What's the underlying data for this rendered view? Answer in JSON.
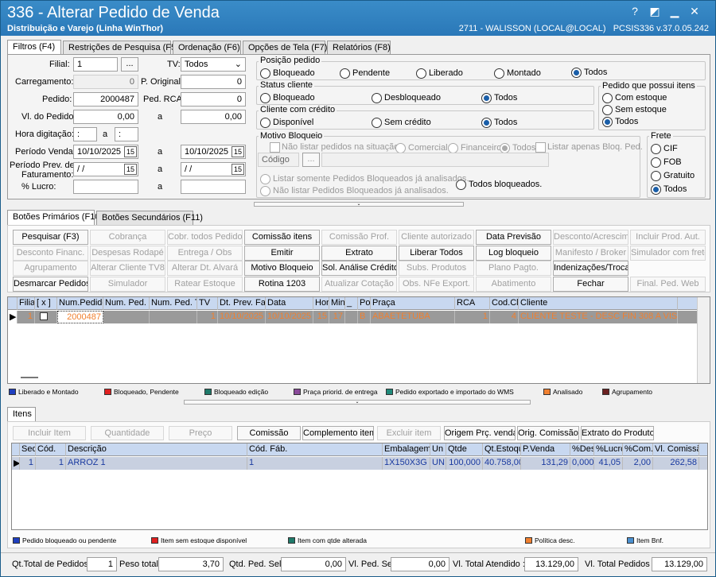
{
  "title": {
    "main": "336 - Alterar Pedido de Venda",
    "sub": "Distribuição e Varejo (Linha WinThor)",
    "user": "2711 - WALISSON (LOCAL@LOCAL)",
    "version": "PCSIS336  v.37.0.05.242"
  },
  "tabs": [
    "Filtros (F4)",
    "Restrições de Pesquisa (F5)",
    "Ordenação (F6)",
    "Opções de Tela (F7)",
    "Relatórios (F8)"
  ],
  "filters": {
    "filial_label": "Filial:",
    "filial": "1",
    "tv_label": "TV:",
    "tv": "Todos",
    "carregamento_label": "Carregamento:",
    "carregamento": "0",
    "poriginal_label": "P. Original:",
    "poriginal": "0",
    "pedido_label": "Pedido:",
    "pedido": "2000487",
    "pedrca_label": "Ped. RCA:",
    "pedrca": "0",
    "vlpedido_label": "Vl. do Pedido:",
    "vlpedido_from": "0,00",
    "a": "a",
    "vlpedido_to": "0,00",
    "hora_label": "Hora digitação:",
    "hora_from": ":",
    "hora_to": ":",
    "periodo_label": "Período Venda:",
    "periodo_from": "10/10/2025",
    "periodo_to": "10/10/2025",
    "periodo_prev_label1": "Período Prev. de",
    "periodo_prev_label2": "Faturamento:",
    "prev_from": "/ /",
    "prev_to": "/ /",
    "lucro_label": "% Lucro:",
    "cal": "15",
    "ellipsis": "..."
  },
  "posicao": {
    "title": "Posição pedido",
    "options": [
      "Bloqueado",
      "Pendente",
      "Liberado",
      "Montado",
      "Todos"
    ]
  },
  "status_cliente": {
    "title": "Status cliente",
    "options": [
      "Bloqueado",
      "Desbloqueado",
      "Todos"
    ]
  },
  "cliente_credito": {
    "title": "Cliente com crédito",
    "options": [
      "Disponível",
      "Sem crédito",
      "Todos"
    ]
  },
  "pedido_itens": {
    "title": "Pedido que possui itens",
    "options": [
      "Com estoque",
      "Sem estoque",
      "Todos"
    ]
  },
  "motivo": {
    "title": "Motivo Bloqueio",
    "nao_listar": "Não listar pedidos na situação:",
    "comercial": "Comercial",
    "financeiro": "Financeiro",
    "todos": "Todos",
    "listar_bloq": "Listar apenas Bloq. Ped.",
    "codigo": "Código",
    "somente": "Listar somente Pedidos Bloqueados já analisados.",
    "nao_listar_bloq": "Não listar Pedidos Bloqueados já analisados.",
    "todos_bloq": "Todos bloqueados."
  },
  "frete": {
    "title": "Frete",
    "options": [
      "CIF",
      "FOB",
      "Gratuito",
      "Todos"
    ]
  },
  "button_tabs": [
    "Botões Primários (F10)",
    "Botões Secundários (F11)"
  ],
  "buttons": [
    [
      "Pesquisar (F3)",
      "Cobrança",
      "Cobr. todos Pedidos",
      "Comissão itens",
      "Comissão Prof.",
      "Cliente autorizado",
      "Data Previsão",
      "Desconto/Acrescimo",
      "Incluir Prod. Aut."
    ],
    [
      "Desconto Financ.",
      "Despesas Rodapé",
      "Entrega / Obs",
      "Emitir",
      "Extrato",
      "Liberar Todos",
      "Log bloqueio",
      "Manifesto / Broker",
      "Simulador com frete"
    ],
    [
      "Agrupamento",
      "Alterar Cliente TV8",
      "Alterar Dt. Alvará",
      "Motivo Bloqueio",
      "Sol. Análise Crédito",
      "Subs. Produtos",
      "Plano Pagto.",
      "Indenizações/Troca",
      ""
    ],
    [
      "Desmarcar Pedidos",
      "Simulador",
      "Ratear Estoque",
      "Rotina 1203",
      "Atualizar Cotação",
      "Obs. NFe Export.",
      "Abatimento",
      "Fechar",
      "Final. Ped. Web"
    ]
  ],
  "orders_grid": {
    "headers": [
      "Filial",
      "[ x ]",
      "Num.Pedido",
      "Num. Ped. B",
      "Num. Ped. T",
      "TV",
      "Dt. Prev. Fa",
      "Data",
      "Hor",
      "Min",
      "_",
      "Pos",
      "Praça",
      "RCA",
      "Cod.Cli",
      "Cliente"
    ],
    "row": [
      "1",
      "",
      "2000487",
      "",
      "",
      "1",
      "10/10/2025",
      "10/10/2025",
      "15",
      "17",
      "",
      "B",
      "ABAETETUBA",
      "1",
      "4",
      "CLIENTE TESTE - DESC FIN 308 A VISTA"
    ]
  },
  "legend1": [
    {
      "label": "Liberado e Montado",
      "color": "#1f3fbf"
    },
    {
      "label": "Bloqueado, Pendente",
      "color": "#e02020"
    },
    {
      "label": "Bloqueado edição",
      "color": "#1f7a6a"
    },
    {
      "label": "Praça priorid. de entrega",
      "color": "#8a4a9a"
    },
    {
      "label": "Pedido exportado e importado do WMS",
      "color": "#1f8a7a"
    },
    {
      "label": "Analisado",
      "color": "#f08030"
    },
    {
      "label": "Agrupamento",
      "color": "#6a2020"
    }
  ],
  "items_tab": "Itens",
  "item_buttons": [
    "Incluir Item",
    "Quantidade",
    "Preço",
    "Comissão",
    "Complemento item",
    "Excluir item",
    "Origem Prç. venda",
    "Orig. Comissão",
    "Extrato do Produto"
  ],
  "items_grid": {
    "headers": [
      "Seq",
      "Cód.",
      "Descrição",
      "Cód. Fáb.",
      "Embalagem",
      "Un",
      "Qtde",
      "Qt.Estoque",
      "P.Venda",
      "%Des",
      "%Lucro",
      "%Com.",
      "Vl. Comissão"
    ],
    "row": [
      "1",
      "1",
      "ARROZ 1",
      "1",
      "1X150X3G",
      "UN",
      "100,000",
      "40.758,00",
      "131,29",
      "0,0000",
      "41,05",
      "2,00",
      "262,58"
    ]
  },
  "legend2": [
    {
      "label": "Pedido bloqueado ou pendente",
      "color": "#1f3fbf"
    },
    {
      "label": "Item sem estoque disponível",
      "color": "#e02020"
    },
    {
      "label": "Item com qtde alterada",
      "color": "#1f7a6a"
    },
    {
      "label": "Política desc.",
      "color": "#f08030"
    },
    {
      "label": "Item Bnf.",
      "color": "#4a90d0"
    }
  ],
  "status": {
    "qt_total_label": "Qt.Total de Pedidos",
    "qt_total": "1",
    "peso_label": "Peso total",
    "peso": "3,70",
    "qtsel_label": "Qtd. Ped. Sel.",
    "qtsel": "0,00",
    "vlsel_label": "Vl. Ped. Sel.",
    "vlsel": "0,00",
    "vlatend_label": "Vl. Total Atendido :",
    "vlatend": "13.129,00",
    "vltotal_label": "Vl. Total Pedidos :",
    "vltotal": "13.129,00"
  }
}
